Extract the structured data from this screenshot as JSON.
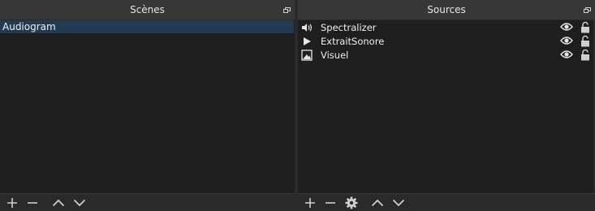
{
  "scenes": {
    "title": "Scènes",
    "items": [
      {
        "label": "Audiogram",
        "selected": true
      }
    ]
  },
  "sources": {
    "title": "Sources",
    "items": [
      {
        "label": "Spectralizer",
        "icon": "speaker-icon"
      },
      {
        "label": "ExtraitSonore",
        "icon": "play-icon"
      },
      {
        "label": "Visuel",
        "icon": "image-icon"
      }
    ]
  },
  "colors": {
    "panel_bg": "#1e1e1e",
    "header_bg": "#373737",
    "selection": "#223a52",
    "text": "#f0f0f0"
  }
}
